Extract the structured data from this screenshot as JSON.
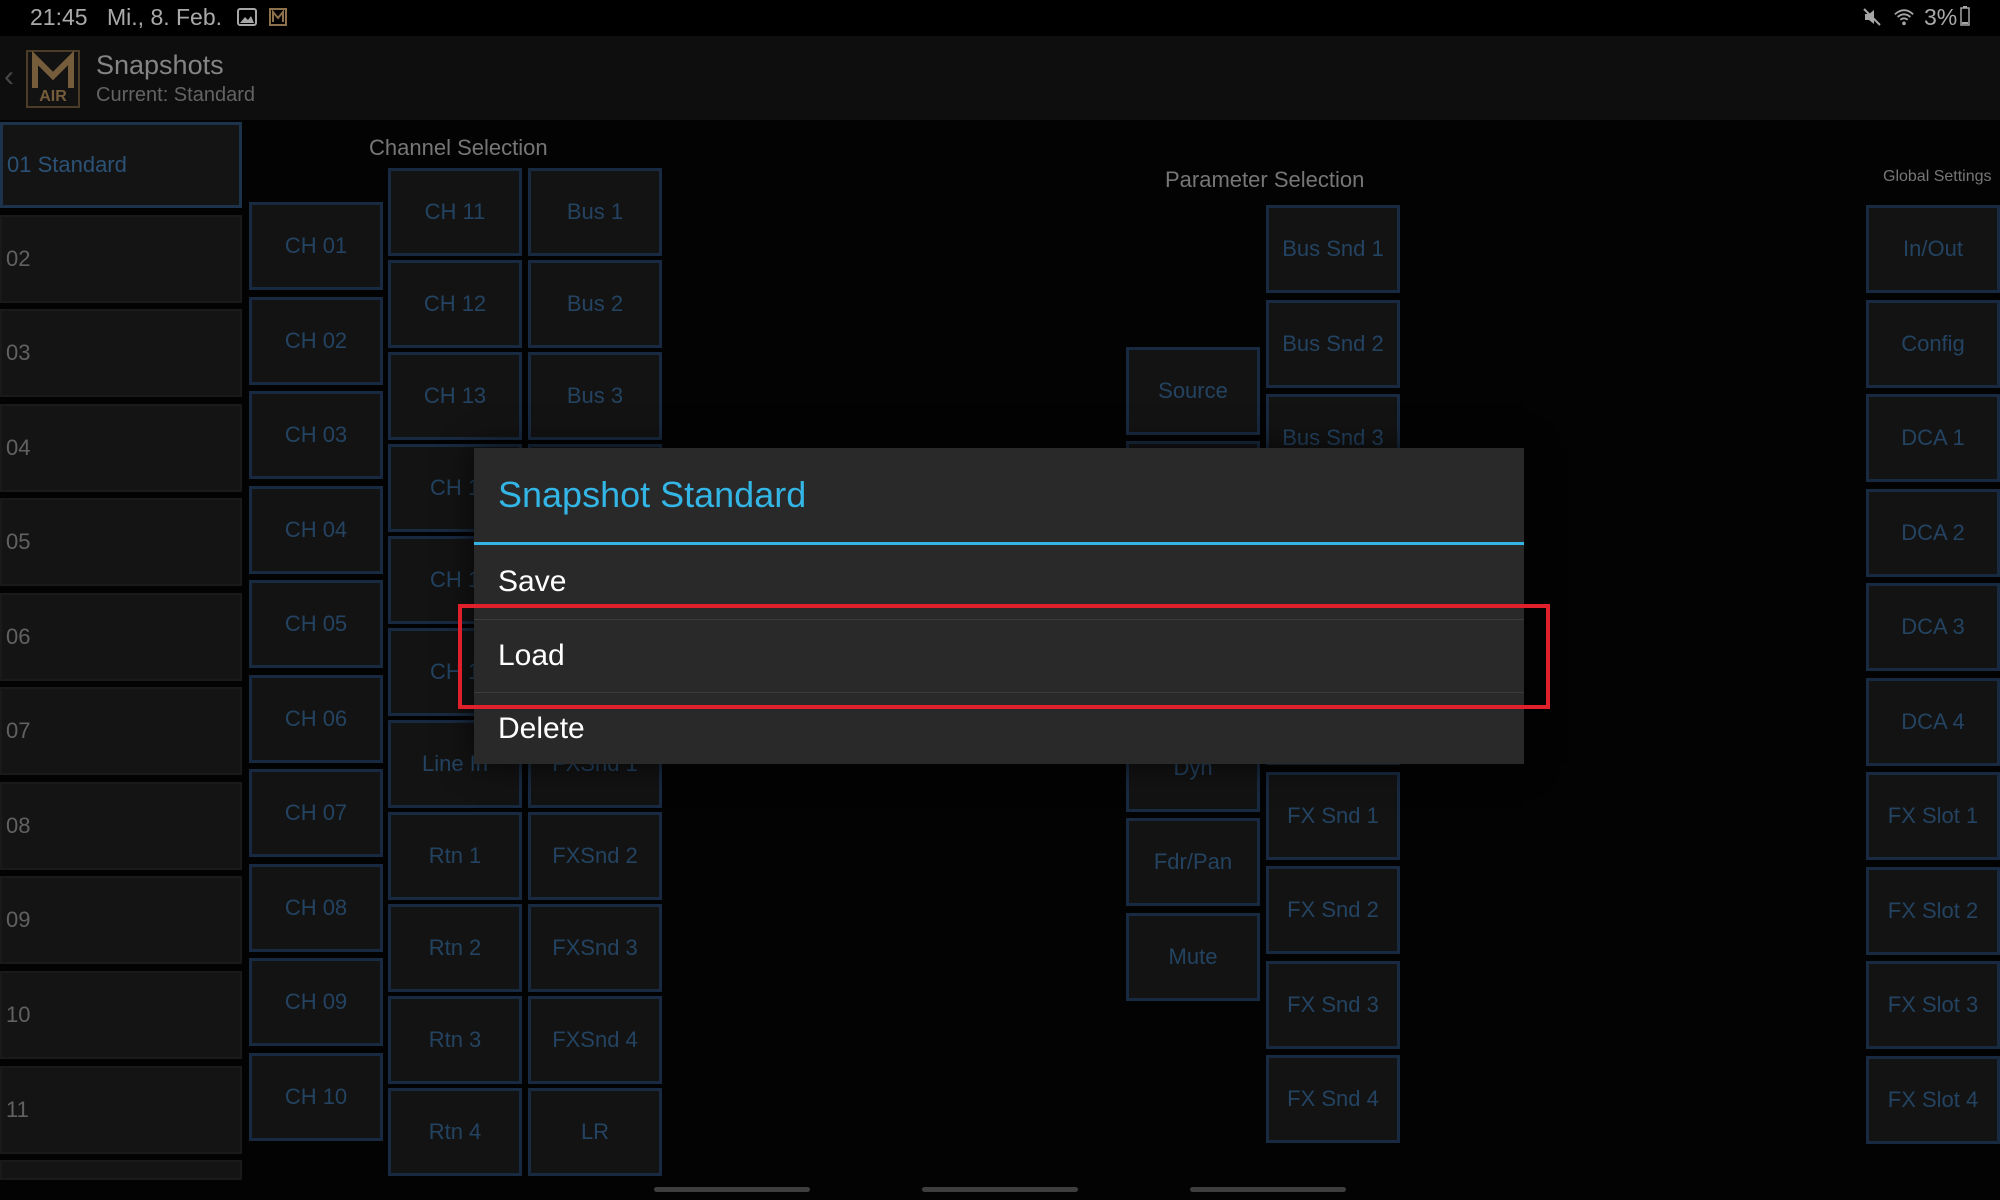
{
  "status_bar": {
    "time": "21:45",
    "date": "Mi., 8. Feb.",
    "battery": "3%",
    "icons": [
      "gallery-icon",
      "m-air-notification-icon",
      "mute-icon",
      "wifi-icon",
      "battery-icon"
    ]
  },
  "header": {
    "back": "‹",
    "title": "Snapshots",
    "subtitle": "Current: Standard",
    "logo_text": "AIR"
  },
  "snapshots": [
    "01 Standard",
    "02",
    "03",
    "04",
    "05",
    "06",
    "07",
    "08",
    "09",
    "10",
    "11"
  ],
  "channel_selection": {
    "label": "Channel Selection",
    "col1": [
      "CH 01",
      "CH 02",
      "CH 03",
      "CH 04",
      "CH 05",
      "CH 06",
      "CH 07",
      "CH 08",
      "CH 09",
      "CH 10"
    ],
    "col2": [
      "CH 11",
      "CH 12",
      "CH 13",
      "CH 1",
      "CH 1",
      "CH 1",
      "Line In",
      "Rtn 1",
      "Rtn 2",
      "Rtn 3",
      "Rtn 4"
    ],
    "col3": [
      "Bus 1",
      "Bus 2",
      "Bus 3",
      "FXSnd 1",
      "FXSnd 2",
      "FXSnd 3",
      "FXSnd 4",
      "LR"
    ]
  },
  "parameter_selection": {
    "label": "Parameter Selection",
    "col1": [
      "Source",
      "Dyn",
      "Fdr/Pan",
      "Mute"
    ],
    "col2": [
      "Bus Snd 1",
      "Bus Snd 2",
      "Bus Snd 3",
      "FX Snd 1",
      "FX Snd 2",
      "FX Snd 3",
      "FX Snd 4"
    ]
  },
  "global_settings": {
    "label": "Global Settings",
    "items": [
      "In/Out",
      "Config",
      "DCA 1",
      "DCA 2",
      "DCA 3",
      "DCA 4",
      "FX Slot 1",
      "FX Slot 2",
      "FX Slot 3",
      "FX Slot 4"
    ]
  },
  "dialog": {
    "title": "Snapshot Standard",
    "items": [
      "Save",
      "Load",
      "Delete"
    ]
  },
  "colors": {
    "accent": "#33b5e5",
    "highlight": "#e0202a",
    "button_border": "#233d5e",
    "button_text": "#33608c"
  }
}
